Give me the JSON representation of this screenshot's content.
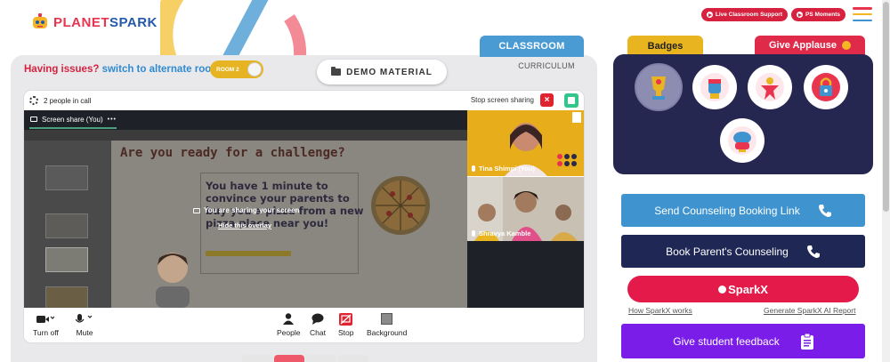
{
  "brand": {
    "logo_text_a": "PLANET",
    "logo_text_b": "SPARK"
  },
  "header": {
    "live_support_label": "Live Classroom Support",
    "ps_moments_label": "PS Moments",
    "hamburger_colors": [
      "#e8344e",
      "#f4b625",
      "#3f94d0"
    ]
  },
  "room": {
    "issues_text": "Having issues?",
    "switch_text": "switch to alternate room",
    "toggle_label": "ROOM 2",
    "demo_material_label": "DEMO MATERIAL",
    "tab_classroom": "CLASSROOM",
    "tab_curriculum": "CURRICULUM"
  },
  "meeting": {
    "people_count_text": "2 people in call",
    "stop_sharing_label": "Stop screen sharing",
    "screen_share_label": "Screen share (You)",
    "more_label": "•••",
    "overlay_message": "You are sharing your screen",
    "hide_overlay_label": "Hide this overlay",
    "slide": {
      "title": "Are you ready for a challenge?",
      "body": "You have 1 minute to convince your parents to buy you a pizza from a new pizza place near you!"
    },
    "participants": [
      {
        "name": "Tina Shimpi (You)"
      },
      {
        "name": "Shravya Kamble"
      }
    ],
    "controls": {
      "camera": "Turn off",
      "mic": "Mute",
      "people": "People",
      "chat": "Chat",
      "stop": "Stop",
      "background": "Background"
    }
  },
  "right_panel": {
    "tab_badges": "Badges",
    "tab_applause": "Give Applause",
    "badges": [
      "trophy-badge",
      "fist-badge",
      "star-person-badge",
      "lock-robot-badge",
      "brain-badge"
    ],
    "send_counseling_label": "Send Counseling Booking Link",
    "book_counseling_label": "Book Parent's Counseling",
    "sparkx_label": "SparkX",
    "how_sparkx_label": "How SparkX works",
    "generate_report_label": "Generate SparkX AI Report",
    "feedback_label": "Give student feedback"
  },
  "colors": {
    "brand_red": "#d6223f",
    "brand_blue": "#3f94d0",
    "navy": "#1f2755",
    "purple": "#7a1de8",
    "yellow": "#e8b520"
  }
}
